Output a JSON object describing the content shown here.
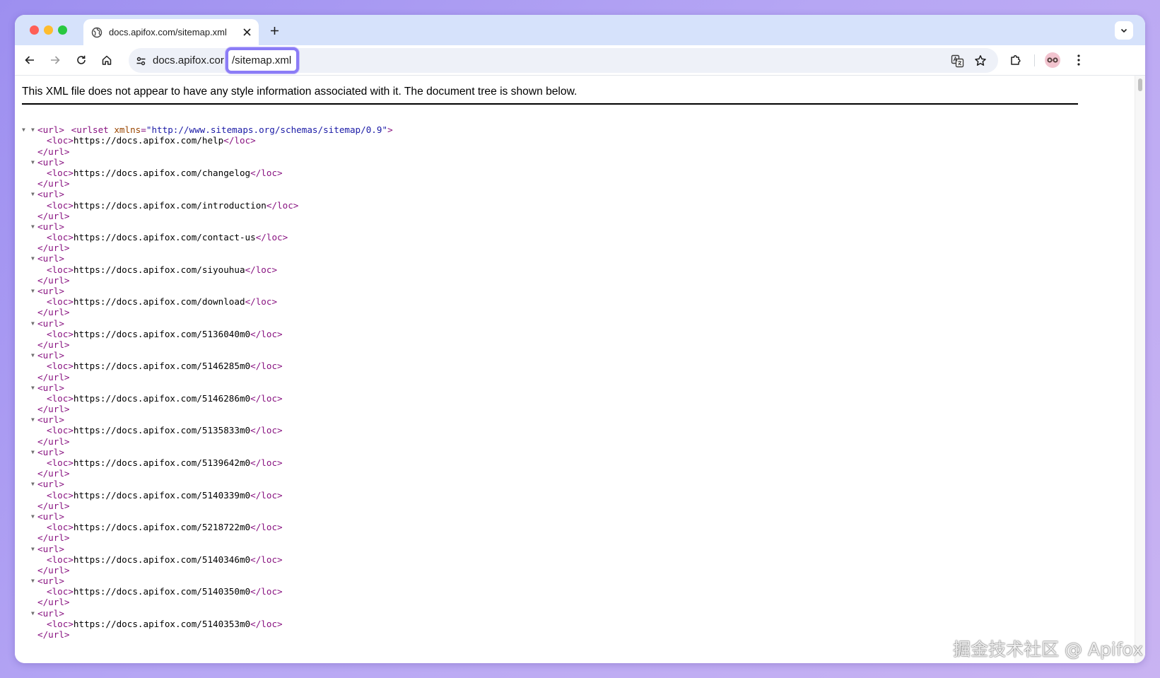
{
  "browser": {
    "tab": {
      "title": "docs.apifox.com/sitemap.xml"
    },
    "url": {
      "host": "docs.apifox.cor",
      "path": "/sitemap.xml"
    },
    "icons": {
      "back": "arrow-left-icon",
      "forward": "arrow-right-icon",
      "reload": "reload-icon",
      "home": "home-icon",
      "site_info": "tune-icon",
      "translate": "translate-icon",
      "bookmark": "star-icon",
      "extensions": "puzzle-icon",
      "menu": "kebab-menu-icon"
    },
    "colors": {
      "accent_highlight": "#8b7cf6",
      "tabstrip": "#d6e2fb"
    }
  },
  "page": {
    "notice": "This XML file does not appear to have any style information associated with it. The document tree is shown below.",
    "xml": {
      "root_open": "<urlset",
      "root_attr_name": "xmlns",
      "root_attr_eq": "=",
      "root_attr_value": "\"http://www.sitemaps.org/schemas/sitemap/0.9\"",
      "root_close_bracket": ">",
      "url_open": "<url>",
      "url_close": "</url>",
      "loc_open": "<loc>",
      "loc_close": "</loc>",
      "fold_icon": "▼",
      "locs": [
        "https://docs.apifox.com/help",
        "https://docs.apifox.com/changelog",
        "https://docs.apifox.com/introduction",
        "https://docs.apifox.com/contact-us",
        "https://docs.apifox.com/siyouhua",
        "https://docs.apifox.com/download",
        "https://docs.apifox.com/5136040m0",
        "https://docs.apifox.com/5146285m0",
        "https://docs.apifox.com/5146286m0",
        "https://docs.apifox.com/5135833m0",
        "https://docs.apifox.com/5139642m0",
        "https://docs.apifox.com/5140339m0",
        "https://docs.apifox.com/5218722m0",
        "https://docs.apifox.com/5140346m0",
        "https://docs.apifox.com/5140350m0",
        "https://docs.apifox.com/5140353m0"
      ]
    }
  },
  "watermark": "掘金技术社区 @ Apifox"
}
